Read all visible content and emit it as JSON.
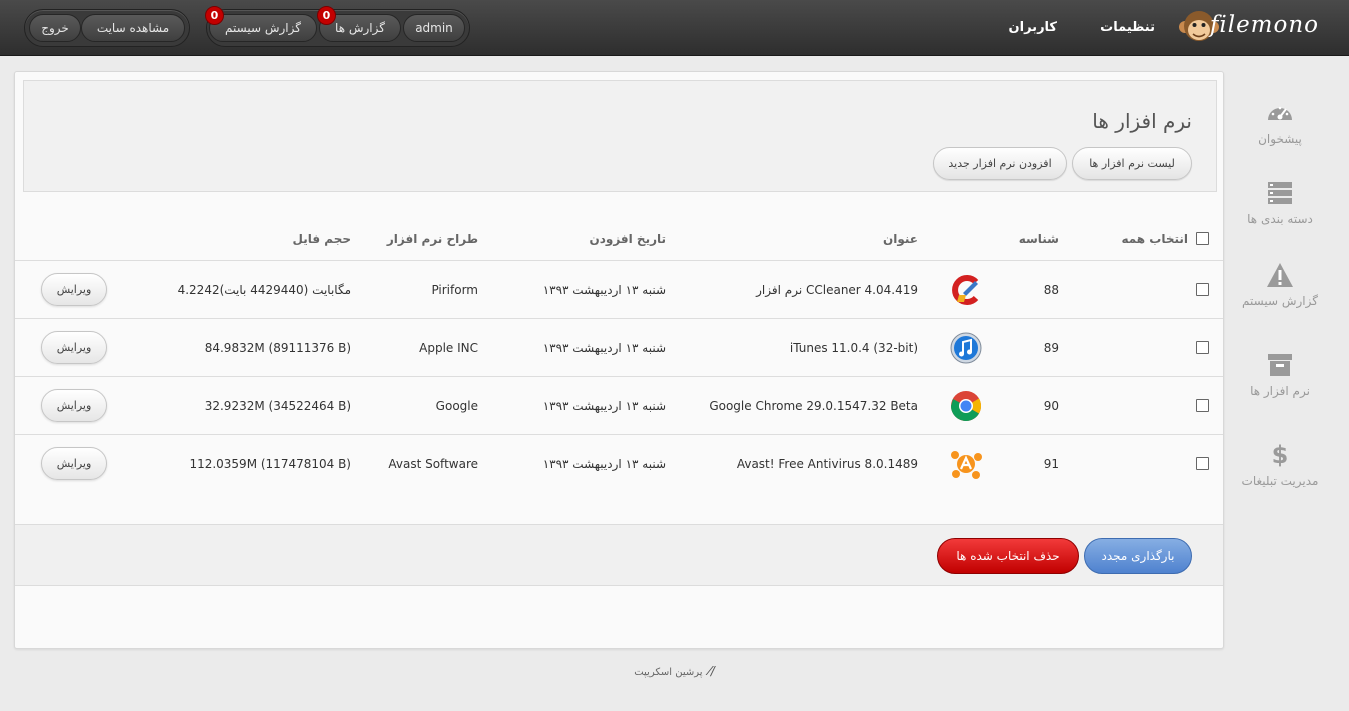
{
  "brand": {
    "name": "filemono"
  },
  "topnav": {
    "settings": "تنظیمات",
    "users": "کاربران"
  },
  "user_group": {
    "username": "admin",
    "reports_label": "گزارش ها",
    "reports_count": "0",
    "system_report_label": "گزارش سیستم",
    "system_report_count": "0"
  },
  "site_group": {
    "view_site": "مشاهده سایت",
    "logout": "خروج"
  },
  "sidebar": {
    "items": [
      {
        "label": "پیشخوان",
        "icon": "dashboard-icon"
      },
      {
        "label": "دسته بندی ها",
        "icon": "categories-icon"
      },
      {
        "label": "گزارش سیستم",
        "icon": "warning-icon"
      },
      {
        "label": "نرم افزار ها",
        "icon": "archive-icon"
      },
      {
        "label": "مدیریت تبلیغات",
        "icon": "dollar-icon"
      }
    ]
  },
  "page": {
    "title": "نرم افزار ها",
    "list_button": "لیست نرم افزار ها",
    "add_button": "افزودن نرم افزار جدید"
  },
  "table": {
    "headers": {
      "select_all": "انتخاب همه",
      "id": "شناسه",
      "title": "عنوان",
      "date": "تاریخ افزودن",
      "developer": "طراح نرم افزار",
      "size": "حجم فایل"
    },
    "rows": [
      {
        "id": "88",
        "title": "نرم افزار CCleaner 4.04.419",
        "icon": "ccleaner-icon",
        "date": "شنبه ۱۳ اردیبهشت ۱۳۹۳",
        "developer": "Piriform",
        "size": "4.2242مگابایت (4429440 بایت)",
        "edit": "ویرایش"
      },
      {
        "id": "89",
        "title": "iTunes 11.0.4 (32-bit)",
        "icon": "itunes-icon",
        "date": "شنبه ۱۳ اردیبهشت ۱۳۹۳",
        "developer": "Apple INC",
        "size": "84.9832M (89111376 B)",
        "edit": "ویرایش"
      },
      {
        "id": "90",
        "title": "Google Chrome 29.0.1547.32 Beta",
        "icon": "chrome-icon",
        "date": "شنبه ۱۳ اردیبهشت ۱۳۹۳",
        "developer": "Google",
        "size": "32.9232M (34522464 B)",
        "edit": "ویرایش"
      },
      {
        "id": "91",
        "title": "Avast! Free Antivirus 8.0.1489",
        "icon": "avast-icon",
        "date": "شنبه ۱۳ اردیبهشت ۱۳۹۳",
        "developer": "Avast Software",
        "size": "112.0359M (117478104 B)",
        "edit": "ویرایش"
      }
    ]
  },
  "actions": {
    "reload": "بارگذاری مجدد",
    "delete_selected": "حذف انتخاب شده ها"
  },
  "footer": {
    "credit": "پرشین اسکریپت"
  },
  "colors": {
    "accent_blue": "#5b8ed6",
    "danger_red": "#d10a0a",
    "badge_red": "#c30000"
  }
}
